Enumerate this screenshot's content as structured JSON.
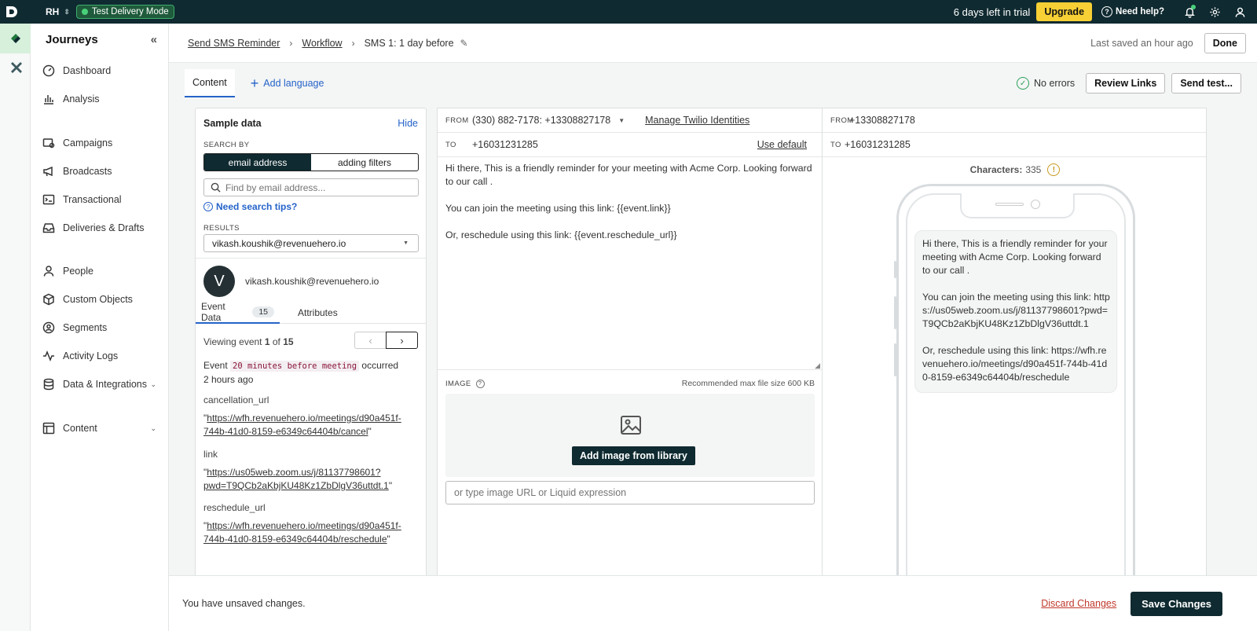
{
  "topbar": {
    "workspace": "RH",
    "mode_badge": "Test Delivery Mode",
    "trial_text": "6 days left in trial",
    "upgrade_label": "Upgrade",
    "help_label": "Need help?"
  },
  "sidebar": {
    "title": "Journeys",
    "items": [
      {
        "label": "Dashboard",
        "icon": "gauge-icon"
      },
      {
        "label": "Analysis",
        "icon": "bar-chart-icon"
      },
      {
        "label": "Campaigns",
        "icon": "campaigns-icon"
      },
      {
        "label": "Broadcasts",
        "icon": "megaphone-icon"
      },
      {
        "label": "Transactional",
        "icon": "terminal-icon"
      },
      {
        "label": "Deliveries & Drafts",
        "icon": "inbox-icon"
      },
      {
        "label": "People",
        "icon": "person-icon"
      },
      {
        "label": "Custom Objects",
        "icon": "cube-icon"
      },
      {
        "label": "Segments",
        "icon": "segments-icon"
      },
      {
        "label": "Activity Logs",
        "icon": "activity-icon"
      },
      {
        "label": "Data & Integrations",
        "icon": "database-icon"
      },
      {
        "label": "Content",
        "icon": "layout-icon"
      }
    ]
  },
  "header": {
    "breadcrumb": [
      "Send SMS Reminder",
      "Workflow"
    ],
    "current": "SMS 1: 1 day before",
    "last_saved": "Last saved an hour ago",
    "done_label": "Done"
  },
  "tabs": {
    "content_tab": "Content",
    "add_language": "Add language",
    "no_errors": "No errors",
    "review_links": "Review Links",
    "send_test": "Send test..."
  },
  "sample": {
    "title": "Sample data",
    "hide": "Hide",
    "search_by_label": "SEARCH BY",
    "seg_email": "email address",
    "seg_filters": "adding filters",
    "search_placeholder": "Find by email address...",
    "tips": "Need search tips?",
    "results_label": "RESULTS",
    "selected_result": "vikash.koushik@revenuehero.io",
    "avatar_letter": "V",
    "person_email": "vikash.koushik@revenuehero.io",
    "tab_event": "Event Data",
    "event_count": "15",
    "tab_attributes": "Attributes",
    "viewing_prefix": "Viewing event ",
    "viewing_current": "1",
    "viewing_of": " of ",
    "viewing_total": "15",
    "event_prefix": "Event ",
    "event_name": "20 minutes before meeting",
    "event_suffix": " occurred",
    "event_time": "2 hours ago",
    "fields": [
      {
        "key": "cancellation_url",
        "value": "https://wfh.revenuehero.io/meetings/d90a451f-744b-41d0-8159-e6349c64404b/cancel"
      },
      {
        "key": "link",
        "value": "https://us05web.zoom.us/j/81137798601?pwd=T9QCb2aKbjKU48Kz1ZbDlgV36uttdt.1"
      },
      {
        "key": "reschedule_url",
        "value": "https://wfh.revenuehero.io/meetings/d90a451f-744b-41d0-8159-e6349c64404b/reschedule"
      }
    ]
  },
  "editor": {
    "from_label": "FROM",
    "from_value": "(330) 882-7178: +13308827178",
    "manage_link": "Manage Twilio Identities",
    "to_label": "TO",
    "to_value": "+16031231285",
    "use_default": "Use default",
    "body": [
      "Hi there, This is a friendly reminder for your meeting with Acme Corp. Looking forward to our call .",
      "You can join the meeting using this link: {{event.link}}",
      "Or, reschedule using this link: {{event.reschedule_url}}"
    ],
    "image_label": "IMAGE",
    "recommended": "Recommended max file size 600 KB",
    "add_image": "Add image from library",
    "url_placeholder": "or type image URL or Liquid expression"
  },
  "preview": {
    "from_label": "FROM",
    "from_value": "+13308827178",
    "to_label": "TO",
    "to_value": "+16031231285",
    "chars_label": "Characters:",
    "chars_value": "335",
    "bubble": [
      "Hi there, This is a friendly reminder for your meeting with Acme Corp. Looking forward to our call .",
      "You can join the meeting using this link: https://us05web.zoom.us/j/81137798601?pwd=T9QCb2aKbjKU48Kz1ZbDlgV36uttdt.1",
      "Or, reschedule using this link: https://wfh.revenuehero.io/meetings/d90a451f-744b-41d0-8159-e6349c64404b/reschedule"
    ]
  },
  "footer": {
    "unsaved": "You have unsaved changes.",
    "discard": "Discard Changes",
    "save": "Save Changes"
  },
  "colors": {
    "topbar": "#0f2a30",
    "accent": "#2563c9",
    "upgrade": "#f7d035",
    "discard": "#c0392b"
  }
}
